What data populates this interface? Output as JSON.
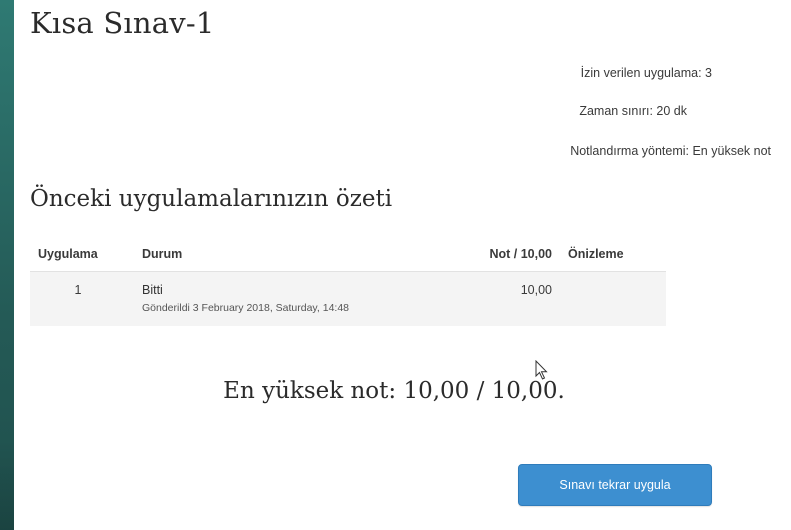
{
  "quiz": {
    "title": "Kısa Sınav-1"
  },
  "info": {
    "attempts_allowed": "İzin verilen uygulama: 3",
    "time_limit": "Zaman sınırı: 20 dk",
    "grading_method": "Notlandırma yöntemi: En yüksek not"
  },
  "summary": {
    "title": "Önceki uygulamalarınızın özeti",
    "columns": {
      "attempt": "Uygulama",
      "state": "Durum",
      "grade": "Not / 10,00",
      "preview": "Önizleme"
    },
    "rows": [
      {
        "attempt": "1",
        "state": "Bitti",
        "submitted": "Gönderildi 3 February 2018, Saturday, 14:48",
        "grade": "10,00",
        "preview": ""
      }
    ]
  },
  "result": {
    "best_grade": "En yüksek not: 10,00 / 10,00."
  },
  "actions": {
    "reattempt_label": "Sınavı tekrar uygula"
  },
  "colors": {
    "frame": "#2e6f6a",
    "button": "#3d8fd0",
    "row_background": "#f4f4f4"
  }
}
